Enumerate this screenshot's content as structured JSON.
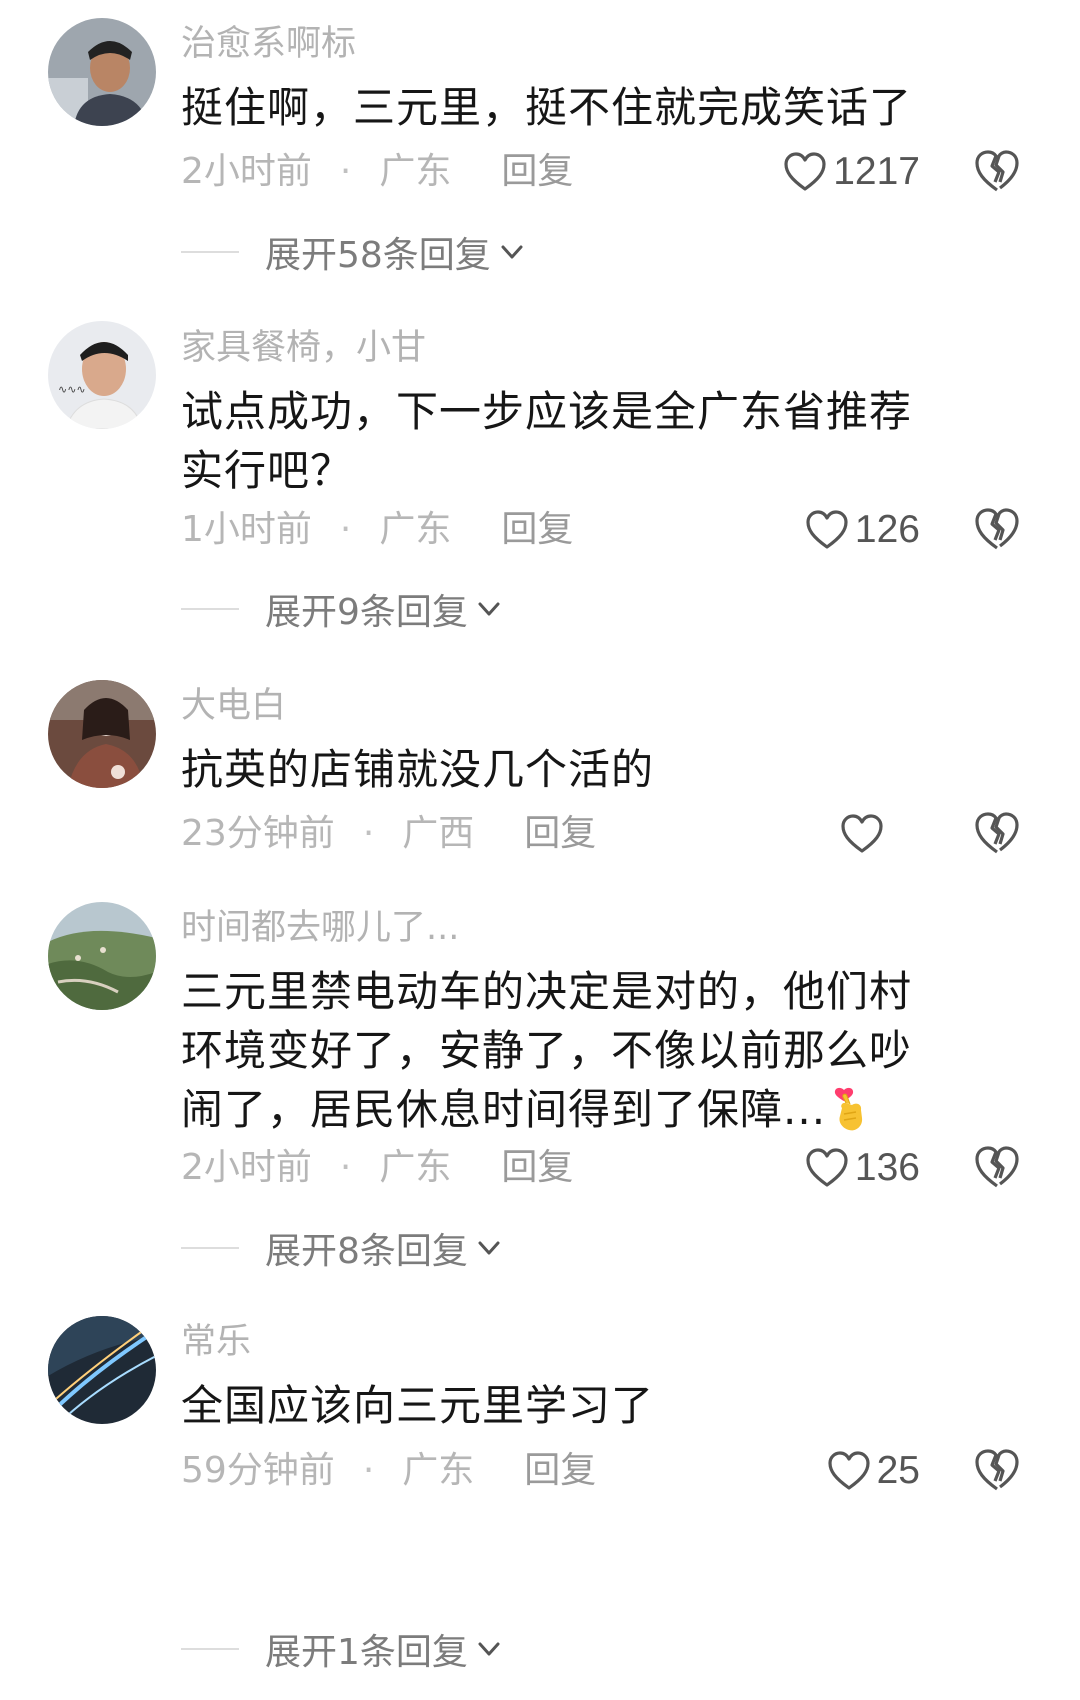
{
  "comments": [
    {
      "username": "治愈系啊标",
      "content": "挺住啊，三元里，挺不住就完成笑话了",
      "time": "2小时前",
      "dot": "·",
      "location": "广东",
      "reply_label": "回复",
      "likes": "1217",
      "expand_label": "展开58条回复"
    },
    {
      "username": "家具餐椅，小甘",
      "content": "试点成功，下一步应该是全广东省推荐实行吧？",
      "time": "1小时前",
      "dot": "·",
      "location": "广东",
      "reply_label": "回复",
      "likes": "126",
      "expand_label": "展开9条回复"
    },
    {
      "username": "大电白",
      "content": "抗英的店铺就没几个活的",
      "time": "23分钟前",
      "dot": "·",
      "location": "广西",
      "reply_label": "回复",
      "likes": ""
    },
    {
      "username": "时间都去哪儿了...",
      "content": "三元里禁电动车的决定是对的，他们村环境变好了，安静了，不像以前那么吵闹了，居民休息时间得到了保障...",
      "emoji": "finger-heart-emoji",
      "time": "2小时前",
      "dot": "·",
      "location": "广东",
      "reply_label": "回复",
      "likes": "136",
      "expand_label": "展开8条回复"
    },
    {
      "username": "常乐",
      "content": "全国应该向三元里学习了",
      "time": "59分钟前",
      "dot": "·",
      "location": "广东",
      "reply_label": "回复",
      "likes": "25",
      "expand_label": "展开1条回复"
    }
  ],
  "icons": {
    "like": "heart-outline-icon",
    "dislike": "broken-heart-icon",
    "expand": "chevron-down-icon"
  },
  "colors": {
    "username": "#b3b3b3",
    "content": "#161616",
    "meta": "#b6b6b6",
    "icon": "#555555"
  }
}
